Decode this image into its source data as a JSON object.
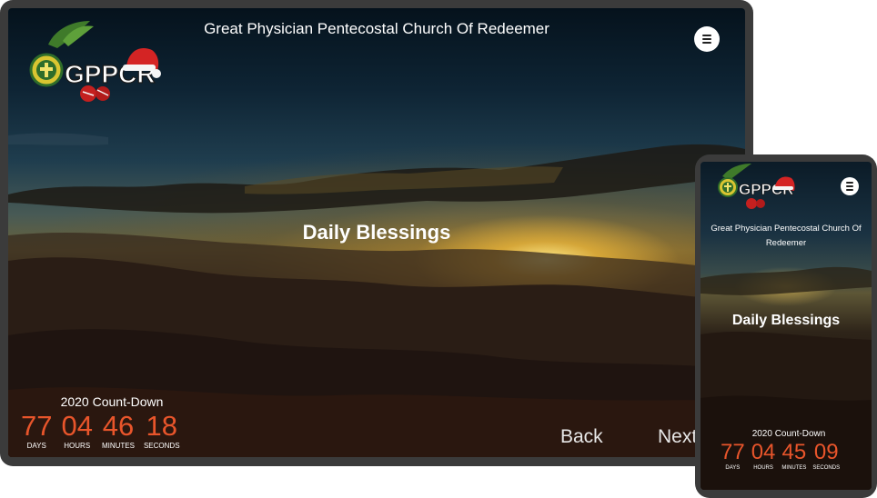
{
  "church_name": "Great Physician Pentecostal Church Of Redeemer",
  "logo_text": "GPPCR",
  "page_heading": "Daily Blessings",
  "countdown": {
    "title": "2020 Count-Down",
    "labels": {
      "days": "DAYS",
      "hours": "HOURS",
      "minutes": "MINUTES",
      "seconds": "SECONDS"
    }
  },
  "tablet": {
    "countdown": {
      "days": "77",
      "hours": "04",
      "minutes": "46",
      "seconds": "18"
    },
    "nav": {
      "back": "Back",
      "next": "Next"
    }
  },
  "phone": {
    "church_name_line1": "Great Physician Pentecostal Church Of",
    "church_name_line2": "Redeemer",
    "countdown": {
      "days": "77",
      "hours": "04",
      "minutes": "45",
      "seconds": "09"
    }
  },
  "colors": {
    "countdown_digits": "#e8552b",
    "device_frame": "#3b3b3b",
    "text": "#ffffff"
  },
  "icons": {
    "menu": "hamburger-icon",
    "logo": "cross-badge-icon",
    "hat": "santa-hat-icon",
    "ornament": "christmas-ornament-icon"
  }
}
